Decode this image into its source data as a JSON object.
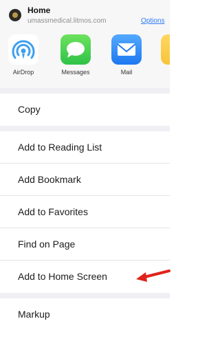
{
  "header": {
    "title": "Home",
    "subtitle": "umassmedical.litmos.com",
    "options_link": "Options"
  },
  "share_row": {
    "items": [
      {
        "label": "AirDrop",
        "icon": "airdrop-icon"
      },
      {
        "label": "Messages",
        "icon": "messages-icon"
      },
      {
        "label": "Mail",
        "icon": "mail-icon"
      },
      {
        "label": "",
        "icon": "app-icon"
      }
    ]
  },
  "actions": {
    "copy": "Copy",
    "reading_list": "Add to Reading List",
    "bookmark": "Add Bookmark",
    "favorites": "Add to Favorites",
    "find": "Find on Page",
    "home_screen": "Add to Home Screen",
    "markup": "Markup"
  },
  "annotation": {
    "icon": "red-arrow-icon",
    "color": "#e0231b"
  },
  "colors": {
    "link": "#2f7bf5",
    "separator": "#efeff4"
  }
}
